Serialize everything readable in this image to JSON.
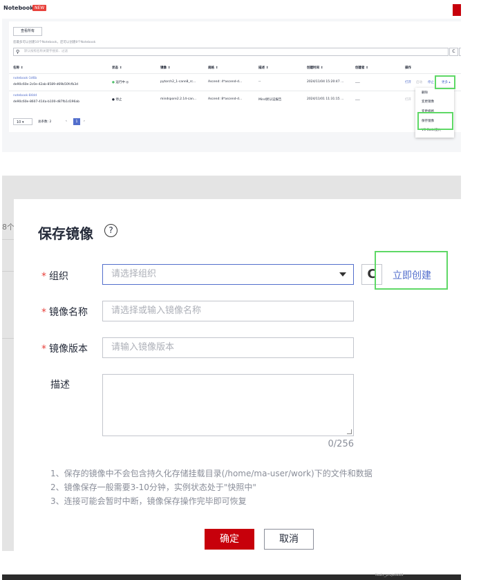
{
  "notebook": {
    "title": "Notebook",
    "new_tag": "NEW",
    "view_all": "查看所有",
    "hint": "您最多可以创建10个Notebook，还可以创建8个Notebook",
    "search_placeholder": "默认按照名称关键字搜索、过滤",
    "columns": [
      "名称 ⇕",
      "状态 ⇕",
      "镜像 ⇕",
      "规格 ⇕",
      "描述 ⇕",
      "创建时间 ⇕",
      "创建者 ⇕",
      "操作"
    ],
    "rows": [
      {
        "name": "notebook-1d6b",
        "id": "de90c60e-2c0e-42ab-8589-d69b50fcfb3d",
        "status": "运行中 ◎",
        "image": "pytorch2_1-cann8_rc...",
        "spec": "Ascend: 4*ascend-d...",
        "desc": "--",
        "created": "2024/11/04 15:20:47 ...",
        "creator": "___",
        "actions": [
          "打开",
          "启动",
          "停止",
          "更多 ▴"
        ]
      },
      {
        "name": "notebook-84dd",
        "id": "de90c60e-8607-414a-b100-d87fb1d196ab",
        "status": "停止",
        "image": "mindspore2.2.14-can...",
        "spec": "Ascend: 8*ascend-d...",
        "desc": "Mind昇认证报告",
        "created": "2024/11/01 11:31:15 ...",
        "creator": "___",
        "actions": [
          "打开"
        ]
      }
    ],
    "page_size": "10",
    "total": "总条数: 2",
    "current_page": "1",
    "page_prev": "‹",
    "page_next": "›",
    "more_menu": [
      "删除",
      "变更镜像",
      "变更规格",
      "保存镜像",
      "VS Code接入"
    ]
  },
  "dialog": {
    "left_fragment": "8个",
    "title": "保存镜像",
    "help_icon": "?",
    "required_mark": "*",
    "org_label": "组织",
    "org_placeholder": "请选择组织",
    "refresh_glyph": "C",
    "create_now": "立即创建",
    "name_label": "镜像名称",
    "name_placeholder": "请选择或输入镜像名称",
    "version_label": "镜像版本",
    "version_placeholder": "请输入镜像版本",
    "desc_label": "描述",
    "desc_counter": "0/256",
    "notes": [
      "1、保存的镜像中不会包含持久化存储挂载目录(/home/ma-user/work)下的文件和数据",
      "2、镜像保存一般需要3-10分钟，实例状态处于\"快照中\"",
      "3、连接可能会暂时中断，镜像保存操作完毕即可恢复"
    ],
    "ok": "确定",
    "cancel": "取消"
  },
  "bottom_bar": {
    "left_text": "Nu2s_proje0228"
  },
  "colors": {
    "brand_red": "#c7000b",
    "link_blue": "#526ecc",
    "highlight_green": "#5ed865"
  }
}
